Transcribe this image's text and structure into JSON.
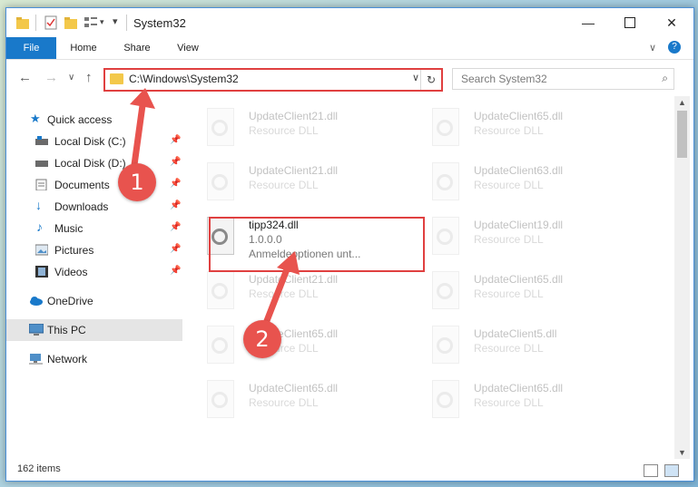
{
  "window": {
    "title": "System32"
  },
  "ribbon": {
    "tabs": [
      "File",
      "Home",
      "Share",
      "View"
    ]
  },
  "address": {
    "path": "C:\\Windows\\System32"
  },
  "search": {
    "placeholder": "Search System32"
  },
  "nav": {
    "items": [
      {
        "label": "Quick access",
        "pinned": false
      },
      {
        "label": "Local Disk (C:)",
        "pinned": true
      },
      {
        "label": "Local Disk (D:)",
        "pinned": true
      },
      {
        "label": "Documents",
        "pinned": true
      },
      {
        "label": "Downloads",
        "pinned": true
      },
      {
        "label": "Music",
        "pinned": true
      },
      {
        "label": "Pictures",
        "pinned": true
      },
      {
        "label": "Videos",
        "pinned": true
      },
      {
        "label": "OneDrive",
        "pinned": false
      },
      {
        "label": "This PC",
        "pinned": false
      },
      {
        "label": "Network",
        "pinned": false
      }
    ]
  },
  "files": [
    {
      "name": "UpdateClient21.dll",
      "desc": "Resource DLL"
    },
    {
      "name": "UpdateClient65.dll",
      "desc": "Resource DLL"
    },
    {
      "name": "UpdateClient21.dll",
      "desc": "Resource DLL"
    },
    {
      "name": "UpdateClient63.dll",
      "desc": "Resource DLL"
    },
    {
      "name": "tipp324.dll",
      "desc": "1.0.0.0",
      "desc2": "Anmeldeoptionen unt..."
    },
    {
      "name": "UpdateClient19.dll",
      "desc": "Resource DLL"
    },
    {
      "name": "UpdateClient21.dll",
      "desc": "Resource DLL"
    },
    {
      "name": "UpdateClient65.dll",
      "desc": "Resource DLL"
    },
    {
      "name": "UpdateClient65.dll",
      "desc": "Resource DLL"
    },
    {
      "name": "UpdateClient5.dll",
      "desc": "Resource DLL"
    },
    {
      "name": "UpdateClient65.dll",
      "desc": "Resource DLL"
    },
    {
      "name": "UpdateClient65.dll",
      "desc": "Resource DLL"
    }
  ],
  "status": {
    "count": "162 items"
  },
  "callouts": [
    "1",
    "2"
  ],
  "colors": {
    "accent": "#1979ca",
    "highlight": "#e04040",
    "callout": "#e8534e"
  }
}
